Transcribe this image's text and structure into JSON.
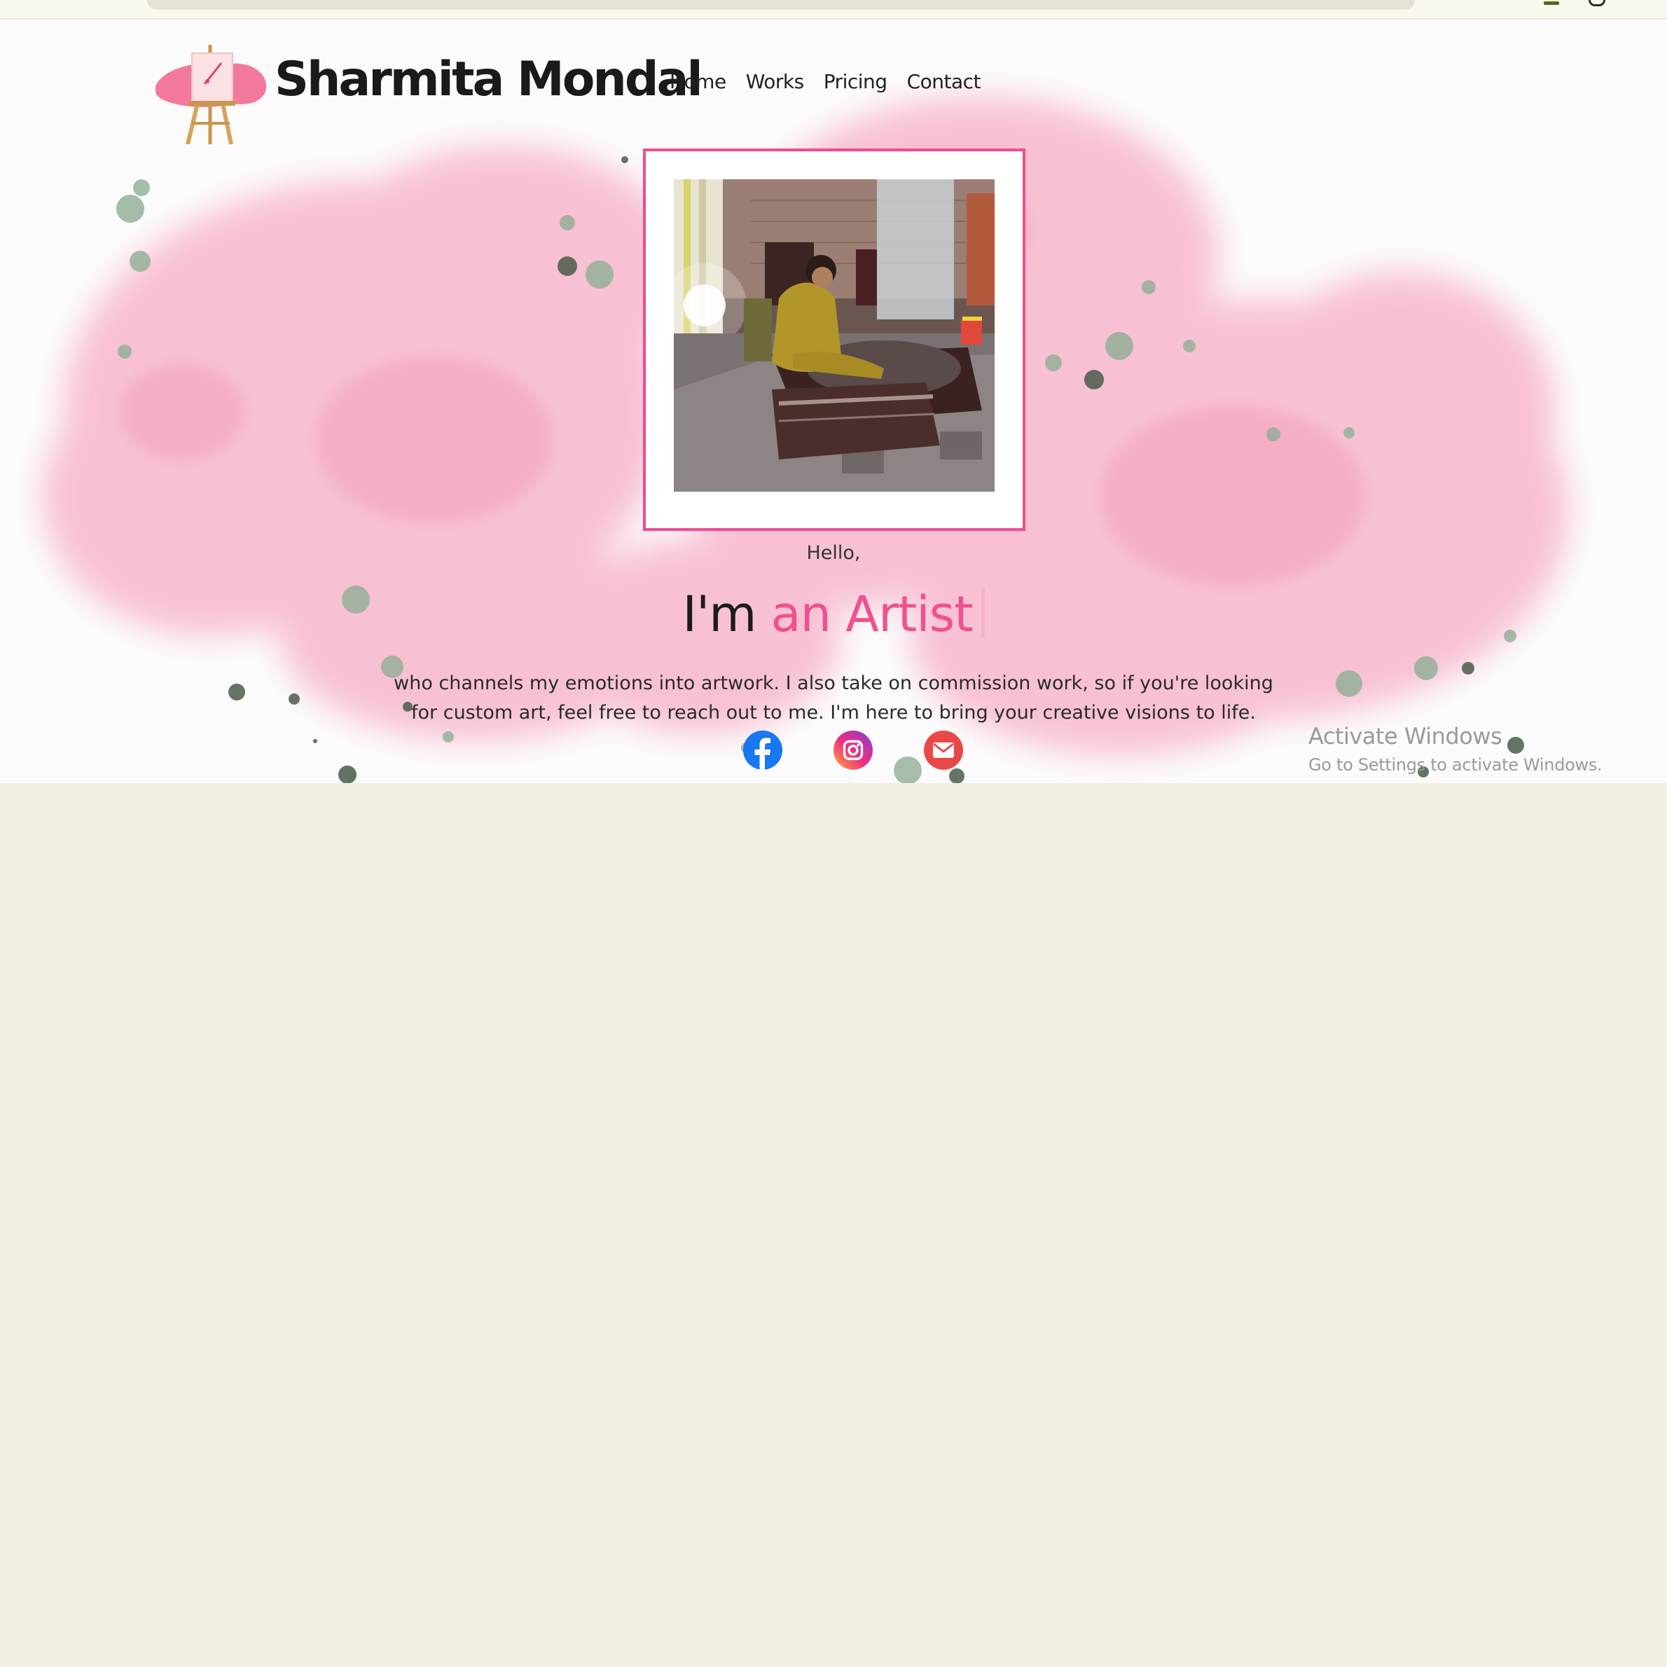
{
  "site": {
    "brand": "Sharmita Mondal",
    "nav": [
      "Home",
      "Works",
      "Pricing",
      "Contact"
    ],
    "hero": {
      "greeting": "Hello,",
      "prefix": "I'm",
      "role": "an Artist",
      "bio": "who channels my emotions into artwork. I also take on commission work, so if you're looking for custom art, feel free to reach out to me. I'm here to bring your creative visions to life."
    },
    "photo_icon": "artist-at-work-photo",
    "socials": [
      {
        "name": "Facebook",
        "icon": "facebook-icon"
      },
      {
        "name": "Instagram",
        "icon": "instagram-icon"
      },
      {
        "name": "Email",
        "icon": "mail-icon"
      }
    ]
  },
  "os_watermark": {
    "title": "Activate Windows",
    "subtitle": "Go to Settings to activate Windows."
  },
  "colors": {
    "accent": "#f0508f",
    "frame_border": "#ee4d90",
    "splash": "#f7b6cc",
    "page_bg": "#f3efe3"
  }
}
